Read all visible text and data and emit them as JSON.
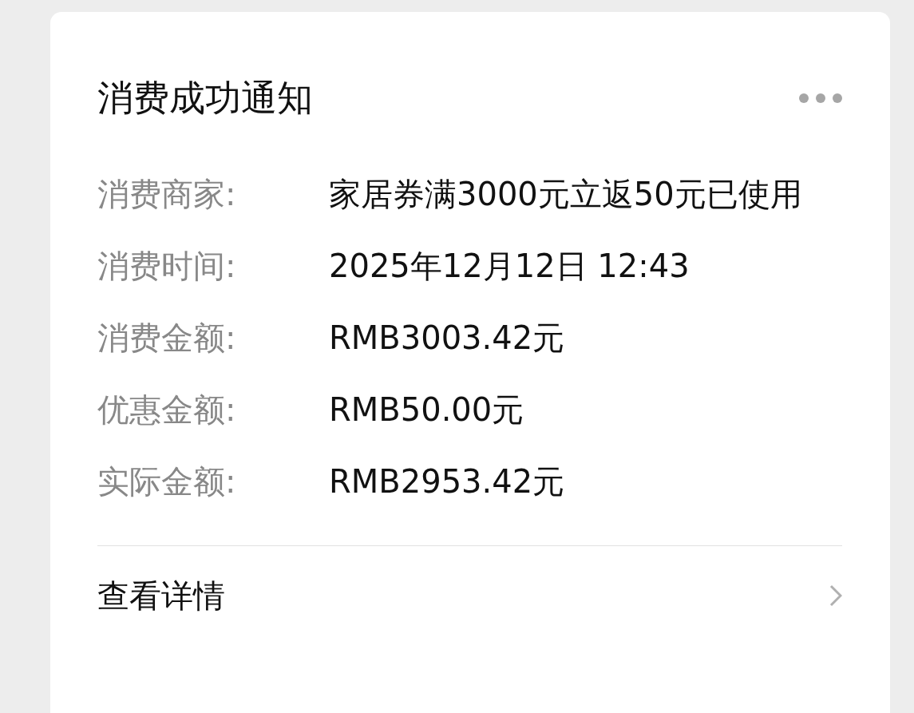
{
  "card": {
    "title": "消费成功通知",
    "fields": [
      {
        "label": "消费商家:",
        "value": "家居券满3000元立返50元已使用"
      },
      {
        "label": "消费时间:",
        "value": "2025年12月12日 12:43"
      },
      {
        "label": "消费金额:",
        "value": "RMB3003.42元"
      },
      {
        "label": "优惠金额:",
        "value": "RMB50.00元"
      },
      {
        "label": "实际金额:",
        "value": "RMB2953.42元"
      }
    ],
    "link": "查看详情"
  }
}
